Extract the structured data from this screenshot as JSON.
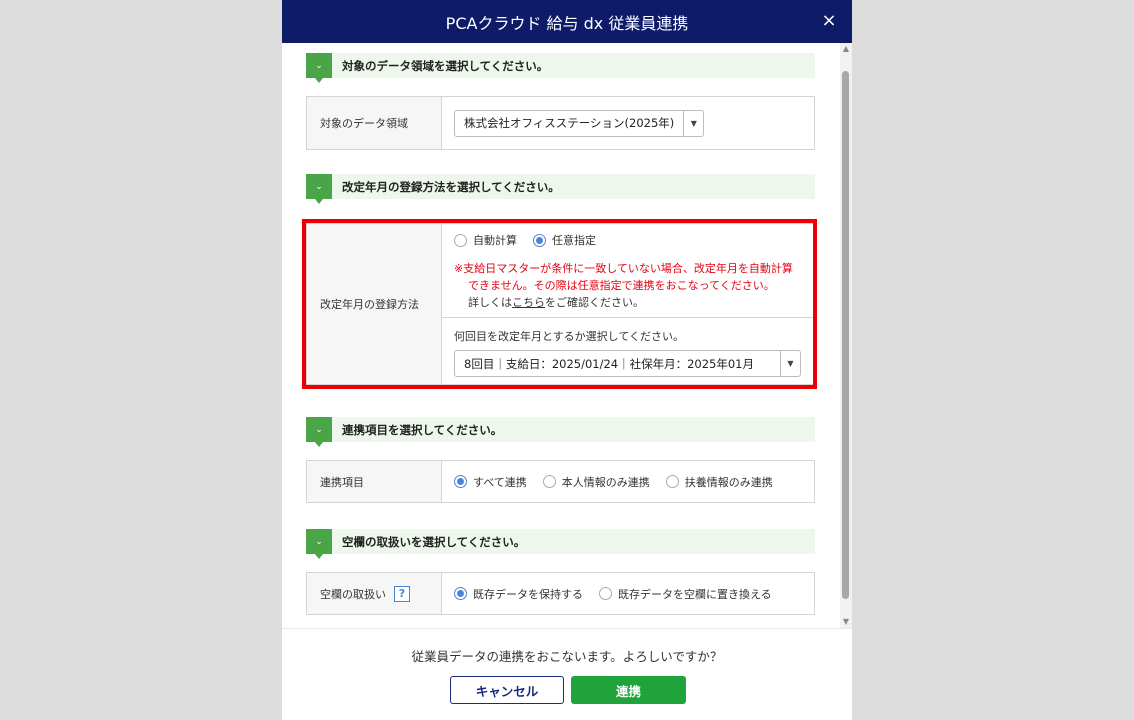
{
  "dialog": {
    "title": "PCAクラウド 給与 dx 従業員連携",
    "close_label": "×"
  },
  "section1": {
    "title": "対象のデータ領域を選択してください。",
    "field_label": "対象のデータ領域",
    "select_value": "株式会社オフィスステーション(2025年)"
  },
  "section2": {
    "title": "改定年月の登録方法を選択してください。",
    "field_label": "改定年月の登録方法",
    "radio_auto": "自動計算",
    "radio_manual": "任意指定",
    "selected": "任意指定",
    "warning_line1": "※支給日マスターが条件に一致していない場合、改定年月を自動計算",
    "warning_line2": "できません。その際は任意指定で連携をおこなってください。",
    "note_prefix": "詳しくは",
    "note_link": "こちら",
    "note_suffix": "をご確認ください。",
    "sub_prompt": "何回目を改定年月とするか選択してください。",
    "select_value": "8回目｜支給日：2025/01/24｜社保年月：2025年01月"
  },
  "section3": {
    "title": "連携項目を選択してください。",
    "field_label": "連携項目",
    "options": [
      "すべて連携",
      "本人情報のみ連携",
      "扶養情報のみ連携"
    ],
    "selected": "すべて連携"
  },
  "section4": {
    "title": "空欄の取扱いを選択してください。",
    "field_label": "空欄の取扱い",
    "help_label": "?",
    "options": [
      "既存データを保持する",
      "既存データを空欄に置き換える"
    ],
    "selected": "既存データを保持する"
  },
  "footer": {
    "confirm_text": "従業員データの連携をおこないます。よろしいですか？",
    "cancel_label": "キャンセル",
    "ok_label": "連携"
  },
  "colors": {
    "titlebar": "#0d1b69",
    "accent_green": "#4aa548",
    "button_green": "#1fa33a",
    "warning_red": "#e60012",
    "highlight_red": "#ee0000",
    "radio_blue": "#4a86d8"
  }
}
